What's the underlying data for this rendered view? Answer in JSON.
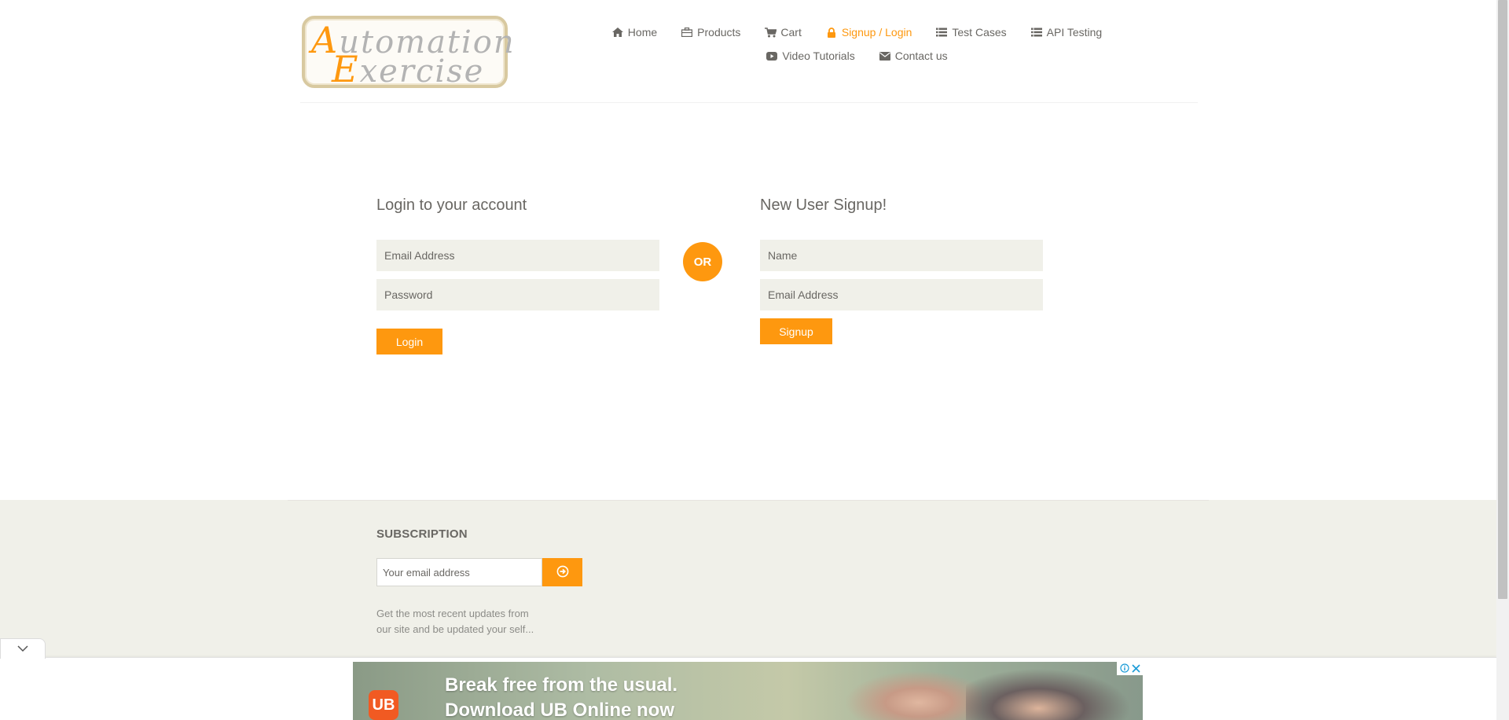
{
  "logo": {
    "line1_cap": "A",
    "line1_rest": "utomation",
    "line2_cap": "E",
    "line2_rest": "xercise"
  },
  "nav": {
    "row1": [
      {
        "label": "Home",
        "icon": "home-icon"
      },
      {
        "label": "Products",
        "icon": "briefcase-icon"
      },
      {
        "label": "Cart",
        "icon": "cart-icon"
      },
      {
        "label": "Signup / Login",
        "icon": "lock-icon",
        "active": true
      },
      {
        "label": "Test Cases",
        "icon": "list-icon"
      },
      {
        "label": "API Testing",
        "icon": "list-icon"
      }
    ],
    "row2": [
      {
        "label": "Video Tutorials",
        "icon": "youtube-play-icon"
      },
      {
        "label": "Contact us",
        "icon": "envelope-icon"
      }
    ]
  },
  "login": {
    "title": "Login to your account",
    "email_placeholder": "Email Address",
    "password_placeholder": "Password",
    "button": "Login"
  },
  "or_label": "OR",
  "signup": {
    "title": "New User Signup!",
    "name_placeholder": "Name",
    "email_placeholder": "Email Address",
    "button": "Signup"
  },
  "footer": {
    "subscription_title": "SUBSCRIPTION",
    "email_placeholder": "Your email address",
    "subscribe_icon": "arrow-circle-right-icon",
    "text_line1": "Get the most recent updates from",
    "text_line2": "our site and be updated your self..."
  },
  "ad": {
    "logo_text": "UB",
    "line1": "Break free from the usual.",
    "line2": "Download UB Online now",
    "collapse_icon": "chevron-down-icon"
  },
  "colors": {
    "accent": "#FE980F",
    "field_bg": "#F0F0E9",
    "text": "#696763",
    "footer_bg": "#F0F0E9"
  }
}
